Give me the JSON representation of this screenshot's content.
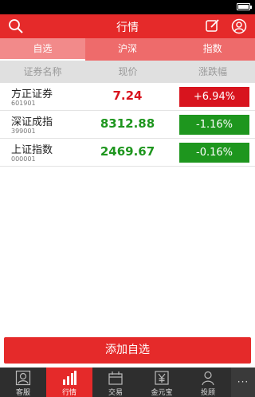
{
  "header": {
    "title": "行情"
  },
  "tabs": [
    {
      "label": "自选",
      "active": true
    },
    {
      "label": "沪深",
      "active": false
    },
    {
      "label": "指数",
      "active": false
    }
  ],
  "columns": {
    "name": "证券名称",
    "price": "现价",
    "change": "涨跌幅"
  },
  "stocks": [
    {
      "name": "方正证券",
      "code": "601901",
      "price": "7.24",
      "change": "+6.94%",
      "direction": "up"
    },
    {
      "name": "深证成指",
      "code": "399001",
      "price": "8312.88",
      "change": "-1.16%",
      "direction": "down"
    },
    {
      "name": "上证指数",
      "code": "000001",
      "price": "2469.67",
      "change": "-0.16%",
      "direction": "down"
    }
  ],
  "add_button": "添加自选",
  "nav": [
    {
      "label": "客服",
      "icon": "customer-service-icon",
      "active": false
    },
    {
      "label": "行情",
      "icon": "market-chart-icon",
      "active": true
    },
    {
      "label": "交易",
      "icon": "trade-icon",
      "active": false
    },
    {
      "label": "金元宝",
      "icon": "yuan-icon",
      "active": false
    },
    {
      "label": "投顾",
      "icon": "advisor-icon",
      "active": false
    }
  ],
  "more_label": "···",
  "colors": {
    "brand": "#e52a2a",
    "up": "#d8141e",
    "down": "#1e961e"
  }
}
